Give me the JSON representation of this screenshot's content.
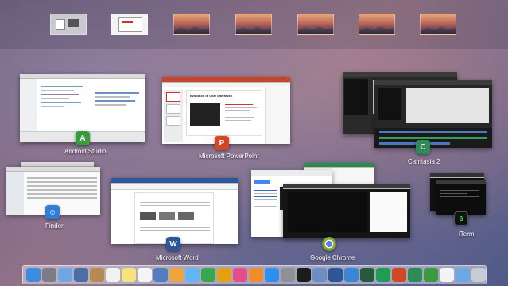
{
  "spaces": [
    {
      "kind": "full1"
    },
    {
      "kind": "full2"
    },
    {
      "kind": "desk"
    },
    {
      "kind": "desk"
    },
    {
      "kind": "desk"
    },
    {
      "kind": "desk"
    },
    {
      "kind": "desk"
    },
    {
      "kind": "desk"
    }
  ],
  "windows": {
    "android_studio": {
      "label": "Android Studio",
      "icon": "android-studio-icon",
      "color": "#3c9a3e"
    },
    "powerpoint": {
      "label": "Microsoft PowerPoint",
      "icon": "powerpoint-icon",
      "color": "#d24726",
      "icon_glyph": "P",
      "slide_title": "Evolution of User Interfaces"
    },
    "camtasia": {
      "label": "Camtasia 2",
      "icon": "camtasia-icon",
      "color": "#2e8b57"
    },
    "finder": {
      "label": "Finder",
      "icon": "finder-icon",
      "color": "#2f7fd8"
    },
    "word": {
      "label": "Microsoft Word",
      "icon": "word-icon",
      "color": "#2b579a",
      "icon_glyph": "W"
    },
    "chrome": {
      "label": "Google Chrome",
      "icon": "chrome-icon",
      "color": "#e4a10f"
    },
    "iterm": {
      "label": "iTerm",
      "icon": "iterm-icon",
      "color": "#111111",
      "icon_glyph": "$"
    }
  },
  "dock": [
    {
      "icon": "finder-icon",
      "color": "#3b8de0"
    },
    {
      "icon": "launchpad-icon",
      "color": "#7c7c86"
    },
    {
      "icon": "mail-icon",
      "color": "#6fa6e4"
    },
    {
      "icon": "photos-icon",
      "color": "#4a6fa3"
    },
    {
      "icon": "preview-icon",
      "color": "#b58b50"
    },
    {
      "icon": "calendar-icon",
      "color": "#f2f2f2"
    },
    {
      "icon": "notes-icon",
      "color": "#f6e27a"
    },
    {
      "icon": "reminders-icon",
      "color": "#f5f5f5"
    },
    {
      "icon": "keynote-icon",
      "color": "#4f7fbf"
    },
    {
      "icon": "photos-app-icon",
      "color": "#f0a53a"
    },
    {
      "icon": "messages-icon",
      "color": "#5fb8f5"
    },
    {
      "icon": "facetime-icon",
      "color": "#3aa64b"
    },
    {
      "icon": "chrome-icon",
      "color": "#e4a10f"
    },
    {
      "icon": "itunes-icon",
      "color": "#e44f8b"
    },
    {
      "icon": "ibooks-icon",
      "color": "#f08c2b"
    },
    {
      "icon": "app-store-icon",
      "color": "#2d8ff0"
    },
    {
      "icon": "system-preferences-icon",
      "color": "#8f8f96"
    },
    {
      "icon": "terminal-icon",
      "color": "#1c1c1c"
    },
    {
      "icon": "finder-window-icon",
      "color": "#6b8fc4"
    },
    {
      "icon": "word-icon",
      "color": "#2b579a"
    },
    {
      "icon": "safari-icon",
      "color": "#3a85d6"
    },
    {
      "icon": "camtasia-dock-icon",
      "color": "#27593b"
    },
    {
      "icon": "hangouts-icon",
      "color": "#1e9e55"
    },
    {
      "icon": "powerpoint-icon",
      "color": "#d24726"
    },
    {
      "icon": "camtasia-icon",
      "color": "#2e8b57"
    },
    {
      "icon": "android-studio-icon",
      "color": "#3c9a3e"
    },
    {
      "icon": "document-icon",
      "color": "#f4f4f4"
    },
    {
      "icon": "folder-icon",
      "color": "#6ba9e6"
    },
    {
      "icon": "trash-icon",
      "color": "#c9ccd2"
    }
  ]
}
